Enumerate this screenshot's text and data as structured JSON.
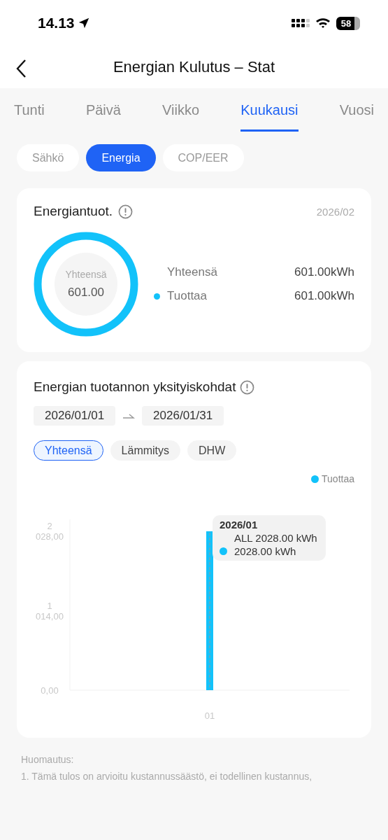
{
  "status_bar": {
    "time": "14.13",
    "battery": "58"
  },
  "nav": {
    "title": "Energian Kulutus – Stat"
  },
  "tabs": [
    {
      "label": "Tunti",
      "selected": false
    },
    {
      "label": "Päivä",
      "selected": false
    },
    {
      "label": "Viikko",
      "selected": false
    },
    {
      "label": "Kuukausi",
      "selected": true
    },
    {
      "label": "Vuosi",
      "selected": false
    }
  ],
  "segments": [
    {
      "label": "Sähkö",
      "selected": false
    },
    {
      "label": "Energia",
      "selected": true
    },
    {
      "label": "COP/EER",
      "selected": false
    }
  ],
  "summary_card": {
    "title": "Energiantuot.",
    "date": "2026/02",
    "donut_label": "Yhteensä",
    "donut_value": "601.00",
    "rows": [
      {
        "label": "Yhteensä",
        "value": "601.00kWh"
      },
      {
        "label": "Tuottaa",
        "value": "601.00kWh",
        "color": "#12c2fa"
      }
    ]
  },
  "details_card": {
    "title": "Energian tuotannon yksityiskohdat",
    "date_from": "2026/01/01",
    "date_to": "2026/01/31",
    "filters": [
      {
        "label": "Yhteensä",
        "selected": true
      },
      {
        "label": "Lämmitys",
        "selected": false
      },
      {
        "label": "DHW",
        "selected": false
      }
    ],
    "chart_data": {
      "type": "bar",
      "categories": [
        "01"
      ],
      "series": [
        {
          "name": "Tuottaa",
          "color": "#12c2fa",
          "values": [
            2028
          ]
        }
      ],
      "ylim": [
        0,
        2180
      ],
      "yticks": [
        {
          "value": 0,
          "label": "0,00"
        },
        {
          "value": 1014,
          "label": "1 014,00"
        },
        {
          "value": 2028,
          "label": "2 028,00"
        }
      ]
    },
    "tooltip": {
      "title": "2026/01",
      "total": "ALL 2028.00 kWh",
      "value": "2028.00 kWh"
    }
  },
  "note": {
    "title": "Huomautus:",
    "lines": [
      "1. Tämä tulos on arvioitu kustannussäästö, ei todellinen kustannus,"
    ]
  }
}
